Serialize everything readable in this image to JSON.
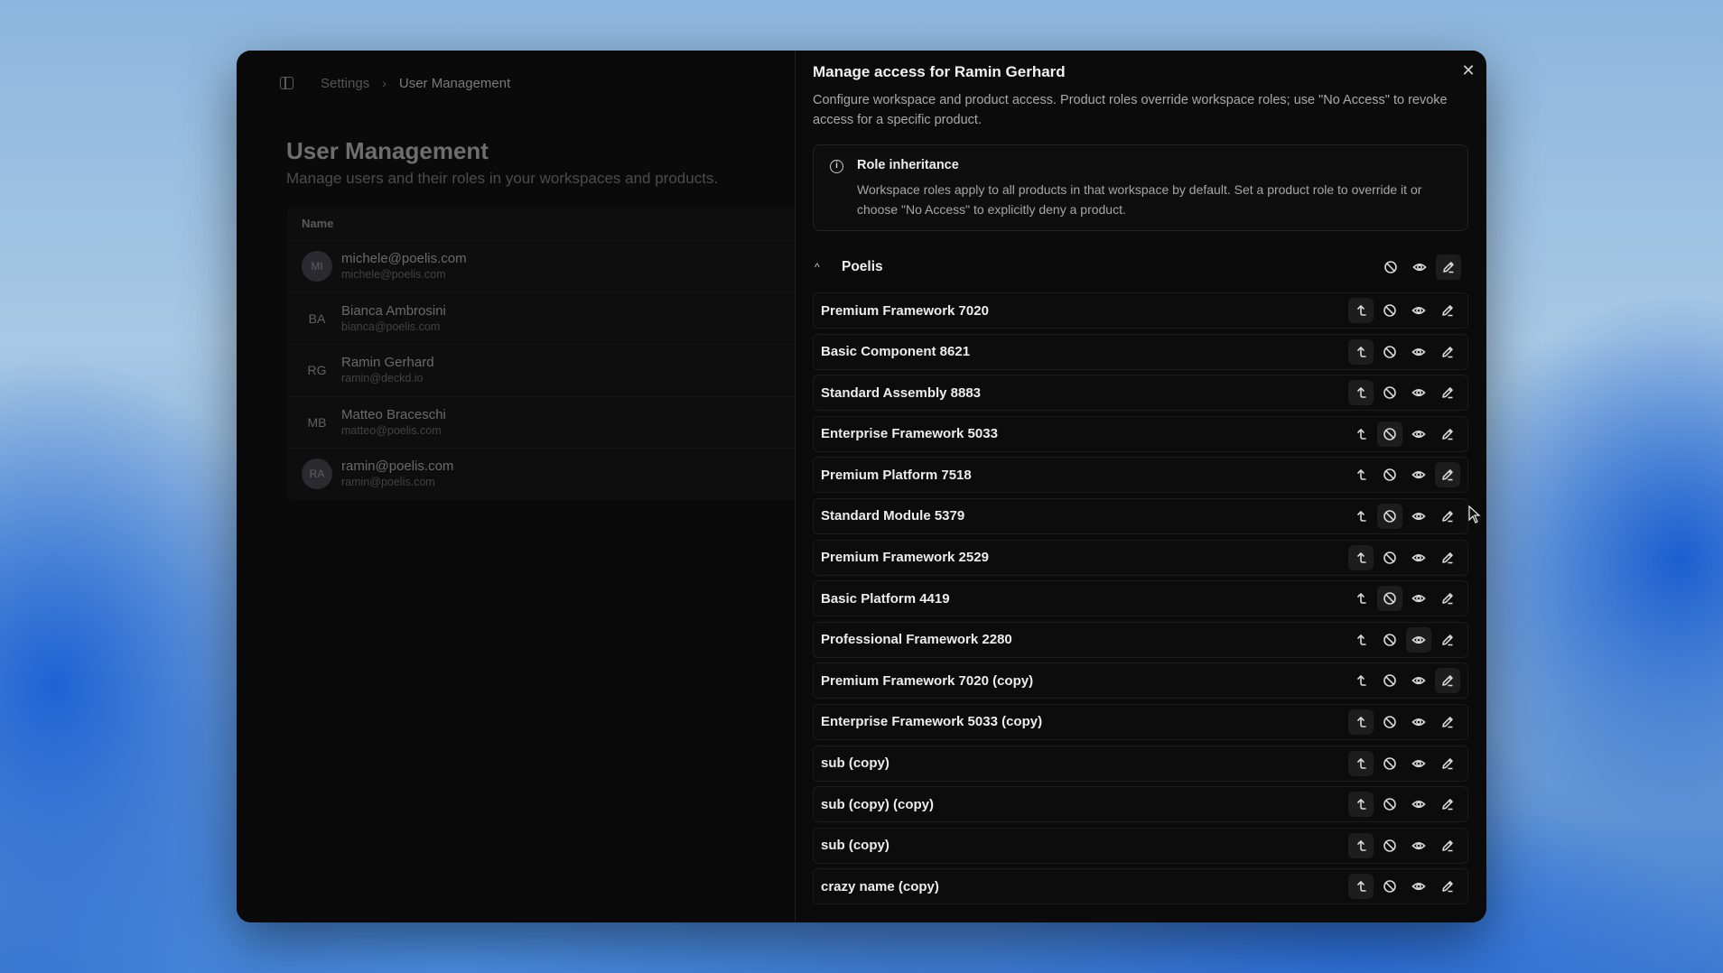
{
  "breadcrumb": {
    "items": [
      "Settings",
      "User Management"
    ],
    "separator": "›"
  },
  "page": {
    "title": "User Management",
    "subtitle": "Manage users and their roles in your workspaces and products."
  },
  "users_table": {
    "column_name": "Name",
    "rows": [
      {
        "initials": "MI",
        "name": "michele@poelis.com",
        "email": "michele@poelis.com",
        "avatar_filled": true
      },
      {
        "initials": "BA",
        "name": "Bianca Ambrosini",
        "email": "bianca@poelis.com",
        "avatar_filled": false
      },
      {
        "initials": "RG",
        "name": "Ramin Gerhard",
        "email": "ramin@deckd.io",
        "avatar_filled": false
      },
      {
        "initials": "MB",
        "name": "Matteo Braceschi",
        "email": "matteo@poelis.com",
        "avatar_filled": false
      },
      {
        "initials": "RA",
        "name": "ramin@poelis.com",
        "email": "ramin@poelis.com",
        "avatar_filled": true
      }
    ]
  },
  "panel": {
    "title": "Manage access for Ramin Gerhard",
    "description": "Configure workspace and product access. Product roles override workspace roles; use \"No Access\" to revoke access for a specific product.",
    "close_icon": "close-icon",
    "info": {
      "title": "Role inheritance",
      "text": "Workspace roles apply to all products in that workspace by default. Set a product role to override it or choose \"No Access\" to explicitly deny a product."
    },
    "workspace": {
      "name": "Poelis",
      "selected_role": "edit"
    },
    "products": [
      {
        "name": "Premium Framework 7020",
        "inherit_active": true,
        "selected": ""
      },
      {
        "name": "Basic Component 8621",
        "inherit_active": true,
        "selected": ""
      },
      {
        "name": "Standard Assembly 8883",
        "inherit_active": true,
        "selected": ""
      },
      {
        "name": "Enterprise Framework 5033",
        "inherit_active": false,
        "selected": "no-access"
      },
      {
        "name": "Premium Platform 7518",
        "inherit_active": false,
        "selected": "edit"
      },
      {
        "name": "Standard Module 5379",
        "inherit_active": false,
        "selected": "no-access"
      },
      {
        "name": "Premium Framework 2529",
        "inherit_active": true,
        "selected": ""
      },
      {
        "name": "Basic Platform 4419",
        "inherit_active": false,
        "selected": "no-access"
      },
      {
        "name": "Professional Framework 2280",
        "inherit_active": false,
        "selected": "view"
      },
      {
        "name": "Premium Framework 7020 (copy)",
        "inherit_active": false,
        "selected": "edit"
      },
      {
        "name": "Enterprise Framework 5033 (copy)",
        "inherit_active": true,
        "selected": ""
      },
      {
        "name": "sub (copy)",
        "inherit_active": true,
        "selected": ""
      },
      {
        "name": "sub (copy) (copy)",
        "inherit_active": true,
        "selected": ""
      },
      {
        "name": "sub (copy)",
        "inherit_active": true,
        "selected": ""
      },
      {
        "name": "crazy name (copy)",
        "inherit_active": true,
        "selected": ""
      }
    ]
  },
  "colors": {
    "accent_text": "#efefef",
    "muted_text": "#a9a9a9",
    "window_bg": "#050505"
  }
}
